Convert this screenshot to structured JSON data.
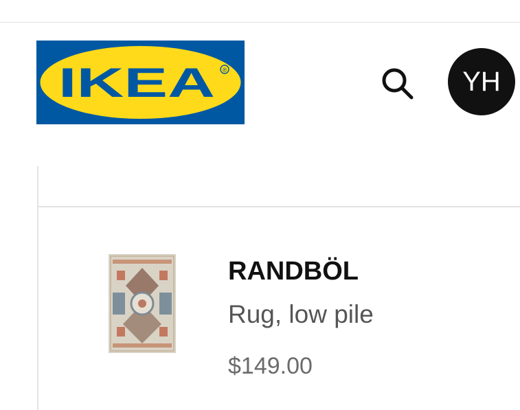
{
  "header": {
    "logo_text": "IKEA",
    "logo_mark": "®",
    "colors": {
      "logo_blue": "#0058a3",
      "logo_yellow": "#ffda1a",
      "avatar_bg": "#111111"
    },
    "search_icon": "search-icon",
    "avatar_initials": "YH"
  },
  "product": {
    "name": "RANDBÖL",
    "description": "Rug, low pile",
    "price": "$149.00",
    "thumbnail_icon": "rug-thumbnail"
  }
}
